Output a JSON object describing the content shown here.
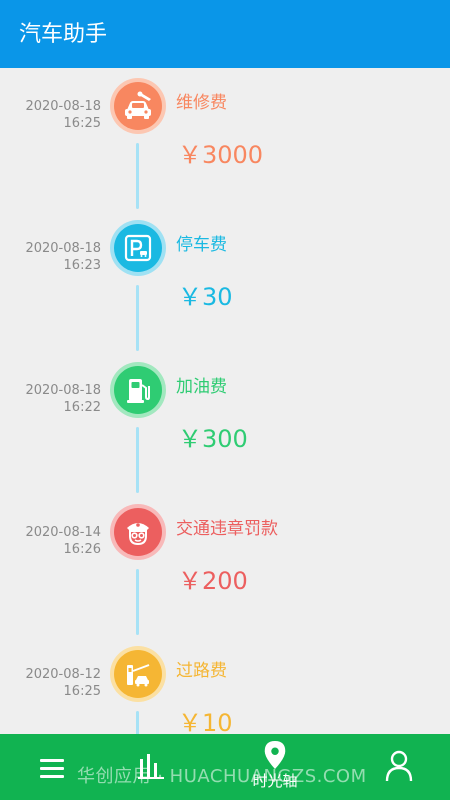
{
  "app": {
    "title": "汽车助手"
  },
  "colors": {
    "appbar": "#0a96e8",
    "bottom_nav": "#11b351",
    "connector": "#a7e2f6"
  },
  "timeline": {
    "entries": [
      {
        "date": "2020-08-18",
        "time": "16:25",
        "label": "维修费",
        "amount": "￥3000",
        "icon": "car-repair-icon",
        "color": "#f88760",
        "ring": "#fcc7b2"
      },
      {
        "date": "2020-08-18",
        "time": "16:23",
        "label": "停车费",
        "amount": "￥30",
        "icon": "parking-icon",
        "color": "#1ab9e2",
        "ring": "#9fe1f3"
      },
      {
        "date": "2020-08-18",
        "time": "16:22",
        "label": "加油费",
        "amount": "￥300",
        "icon": "fuel-pump-icon",
        "color": "#2fcc73",
        "ring": "#a2e8bf"
      },
      {
        "date": "2020-08-14",
        "time": "16:26",
        "label": "交通违章罚款",
        "amount": "￥200",
        "icon": "traffic-police-icon",
        "color": "#ec5f5f",
        "ring": "#f8b9b9"
      },
      {
        "date": "2020-08-12",
        "time": "16:25",
        "label": "过路费",
        "amount": "￥10",
        "icon": "toll-gate-icon",
        "color": "#f5b634",
        "ring": "#fbe0a3"
      }
    ]
  },
  "bottom_nav": {
    "items": [
      {
        "icon": "menu-icon",
        "label": ""
      },
      {
        "icon": "bar-chart-icon",
        "label": ""
      },
      {
        "icon": "location-pin-icon",
        "label": "时光轴",
        "active": true
      },
      {
        "icon": "user-icon",
        "label": ""
      }
    ]
  },
  "watermark": "华创应用 · HUACHUANGZS.COM"
}
